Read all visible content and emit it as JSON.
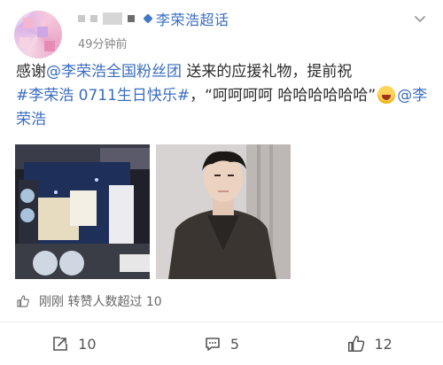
{
  "header": {
    "topic_name": "李荣浩超话",
    "time": "49分钟前"
  },
  "post": {
    "text_prefix": "感谢",
    "mention_fan_group": "@李荣浩全国粉丝团",
    "text_mid": " 送来的应援礼物，提前祝",
    "hashtag": "#李荣浩 0711生日快乐#",
    "text_quote": "，“呵呵呵呵 哈哈哈哈哈哈”",
    "mention_artist": "@李荣浩"
  },
  "images": [
    {
      "name": "gift-box-photo"
    },
    {
      "name": "portrait-photo"
    }
  ],
  "engagement": {
    "like_note": "刚刚 转赞人数超过 10"
  },
  "actions": {
    "repost_count": "10",
    "comment_count": "5",
    "like_count": "12"
  },
  "colors": {
    "link": "#3a6dbf",
    "text": "#2b2b2b",
    "muted": "#888888"
  }
}
